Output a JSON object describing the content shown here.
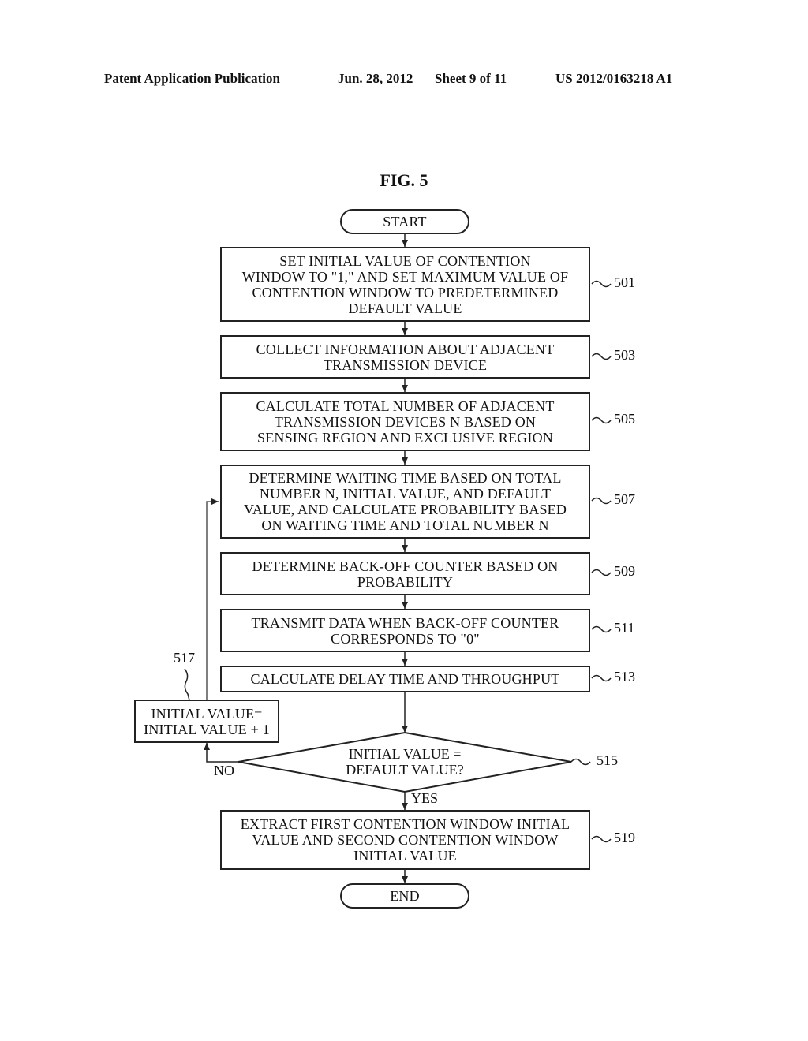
{
  "header": {
    "publication": "Patent Application Publication",
    "date": "Jun. 28, 2012",
    "sheet": "Sheet 9 of 11",
    "number": "US 2012/0163218 A1"
  },
  "figure": {
    "title": "FIG. 5",
    "start": "START",
    "end": "END",
    "steps": [
      {
        "ref": "501",
        "text": "SET INITIAL VALUE OF CONTENTION\nWINDOW TO \"1,\" AND SET MAXIMUM VALUE OF\nCONTENTION WINDOW TO PREDETERMINED\nDEFAULT VALUE"
      },
      {
        "ref": "503",
        "text": "COLLECT INFORMATION ABOUT ADJACENT\nTRANSMISSION DEVICE"
      },
      {
        "ref": "505",
        "text": "CALCULATE TOTAL NUMBER OF ADJACENT\nTRANSMISSION DEVICES N BASED ON\nSENSING REGION AND EXCLUSIVE REGION"
      },
      {
        "ref": "507",
        "text": "DETERMINE WAITING TIME BASED ON TOTAL\nNUMBER N, INITIAL VALUE, AND DEFAULT\nVALUE, AND CALCULATE PROBABILITY BASED\nON WAITING TIME AND TOTAL NUMBER N"
      },
      {
        "ref": "509",
        "text": "DETERMINE BACK-OFF COUNTER BASED ON\nPROBABILITY"
      },
      {
        "ref": "511",
        "text": "TRANSMIT DATA WHEN BACK-OFF COUNTER\nCORRESPONDS TO \"0\""
      },
      {
        "ref": "513",
        "text": "CALCULATE DELAY TIME AND THROUGHPUT"
      },
      {
        "ref": "519",
        "text": "EXTRACT FIRST CONTENTION WINDOW INITIAL\nVALUE AND SECOND CONTENTION WINDOW\nINITIAL VALUE"
      }
    ],
    "decision": {
      "ref": "515",
      "text": "INITIAL VALUE =\nDEFAULT VALUE?",
      "yes_label": "YES",
      "no_label": "NO"
    },
    "loop_box": {
      "ref": "517",
      "text": "INITIAL VALUE=\nINITIAL VALUE + 1"
    }
  }
}
